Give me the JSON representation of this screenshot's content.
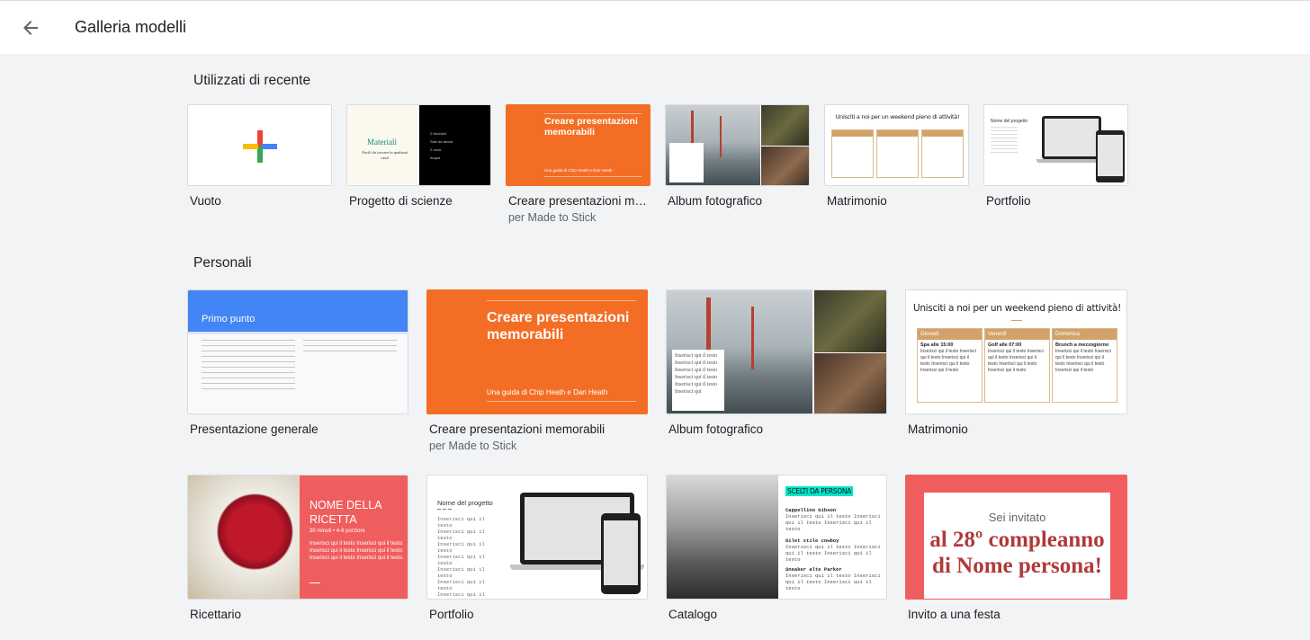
{
  "header": {
    "title": "Galleria modelli",
    "back_icon": "arrow-back-icon"
  },
  "sections": {
    "recent": {
      "title": "Utilizzati di recente",
      "cards": [
        {
          "label": "Vuoto",
          "subtitle": ""
        },
        {
          "label": "Progetto di scienze",
          "subtitle": "",
          "thumb_title": "Materiali",
          "thumb_subtitle": "Facili da trovare in qualsiasi casa!",
          "thumb_items": [
            "2 bicchieri",
            "Sale da tavola",
            "2 uova",
            "Acqua"
          ]
        },
        {
          "label": "Creare presentazioni memorabili",
          "subtitle": "per Made to Stick",
          "thumb_title": "Creare presentazioni memorabili",
          "thumb_subtitle": "Una guida di Chip Heath e Dan Heath"
        },
        {
          "label": "Album fotografico",
          "subtitle": ""
        },
        {
          "label": "Matrimonio",
          "subtitle": "",
          "thumb_title": "Unisciti a noi per un weekend pieno di attività!"
        },
        {
          "label": "Portfolio",
          "subtitle": "",
          "thumb_title": "Nome del progetto"
        }
      ]
    },
    "personal": {
      "title": "Personali",
      "cards": [
        {
          "label": "Presentazione generale",
          "subtitle": "",
          "thumb_title": "Primo punto"
        },
        {
          "label": "Creare presentazioni memorabili",
          "subtitle": "per Made to Stick",
          "thumb_title": "Creare presentazioni memorabili",
          "thumb_subtitle": "Una guida di Chip Heath e Dan Heath"
        },
        {
          "label": "Album fotografico",
          "subtitle": "",
          "thumb_text": "Inserisci qui il testo Inserisci qui il testo Inserisci qui il testo Inserisci qui il testo Inserisci qui il testo Inserisci qui"
        },
        {
          "label": "Matrimonio",
          "subtitle": "",
          "thumb_title": "Unisciti a noi per un weekend pieno di attività!",
          "days": [
            {
              "day": "Giovedì",
              "event": "Spa alle 15:00"
            },
            {
              "day": "Venerdì",
              "event": "Golf alle 07:00"
            },
            {
              "day": "Domenica",
              "event": "Brunch a mezzogiorno"
            }
          ],
          "filler": "Inserisci qui il testo Inserisci qui il testo Inserisci qui il testo Inserisci qui il testo Inserisci qui il testo"
        },
        {
          "label": "Ricettario",
          "subtitle": "",
          "thumb_title": "NOME DELLA RICETTA",
          "thumb_meta": "30 minuti • 4-6 porzioni",
          "thumb_text": "Inserisci qui il testo Inserisci qui il testo Inserisci qui il testo Inserisci qui il testo Inserisci qui il testo Inserisci qui il testo."
        },
        {
          "label": "Portfolio",
          "subtitle": "",
          "thumb_title": "Nome del progetto",
          "thumb_text": "Inserisci qui il testo"
        },
        {
          "label": "Catalogo",
          "subtitle": "",
          "thumb_title": "SCELTI DA PERSONA",
          "items": [
            {
              "name": "Cappellino Gibson",
              "text": "Inserisci qui il testo Inserisci qui il testo Inserisci qui il testo"
            },
            {
              "name": "Gilet stile cowboy",
              "text": "Inserisci qui il testo Inserisci qui il testo Inserisci qui il testo"
            },
            {
              "name": "Sneaker alte Parker",
              "text": "Inserisci qui il testo Inserisci qui il testo Inserisci qui il testo"
            }
          ]
        },
        {
          "label": "Invito a una festa",
          "subtitle": "",
          "thumb_pre": "Sei invitato",
          "thumb_title": "al 28º compleanno di Nome persona!"
        }
      ]
    }
  },
  "colors": {
    "accent_orange": "#f36e24",
    "google_blue": "#4285f4",
    "recipe_red": "#f05d5e",
    "party_red": "#f05d5e",
    "party_title": "#b03a3a",
    "wedding_tan": "#d2a26a"
  }
}
